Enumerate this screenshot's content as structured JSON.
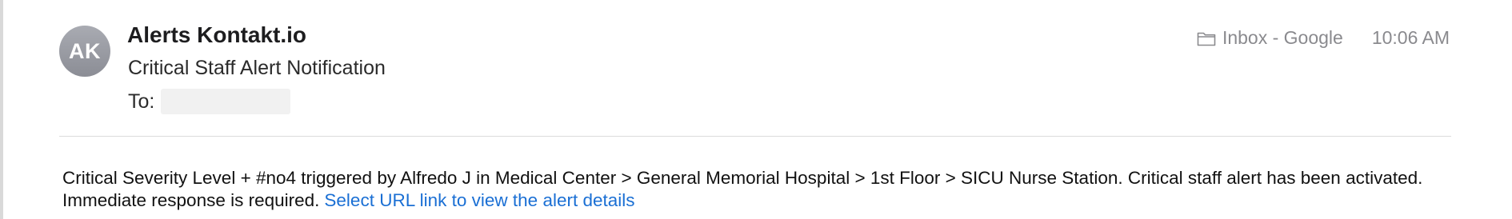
{
  "email": {
    "sender_initials": "AK",
    "sender_name": "Alerts Kontakt.io",
    "subject": "Critical Staff Alert Notification",
    "to_label": "To:",
    "folder_icon": "folder-icon",
    "folder_label": "Inbox - Google",
    "time": "10:06 AM",
    "body": "Critical Severity Level + #no4 triggered by Alfredo J in Medical Center > General Memorial Hospital > 1st Floor > SICU Nurse Station. Critical staff alert has been activated. Immediate response is required.",
    "link_text": "Select URL link to view the alert details"
  },
  "colors": {
    "avatar": "#9a9ca3",
    "link": "#1a6fd4",
    "meta_text": "#8a8a8e"
  }
}
